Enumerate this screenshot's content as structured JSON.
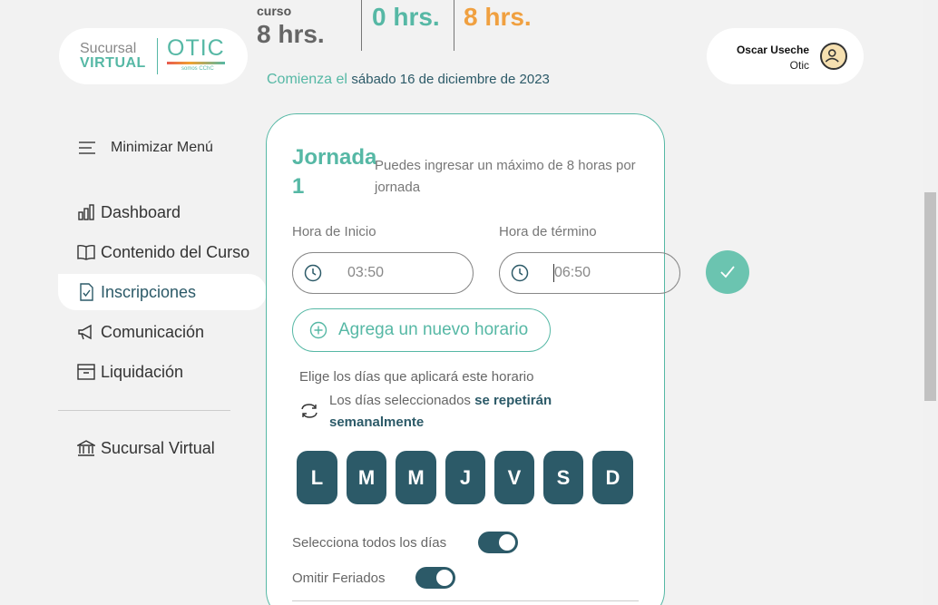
{
  "logo": {
    "line1": "Sucursal",
    "line2": "VIRTUAL",
    "brand": "OTIC",
    "brand_sub": "somos CChC"
  },
  "stats": {
    "curso_label": "curso",
    "curso_value": "8 hrs.",
    "value2": "0 hrs.",
    "value3": "8 hrs."
  },
  "begins": {
    "label": "Comienza el",
    "date": "sábado 16 de diciembre de 2023"
  },
  "user": {
    "name": "Oscar Useche",
    "org": "Otic"
  },
  "sidebar": {
    "toggle_label": "Minimizar Menú",
    "items": [
      {
        "label": "Dashboard",
        "icon": "bar-chart-icon"
      },
      {
        "label": "Contenido del Curso",
        "icon": "book-icon"
      },
      {
        "label": "Inscripciones",
        "icon": "document-check-icon"
      },
      {
        "label": "Comunicación",
        "icon": "megaphone-icon"
      },
      {
        "label": "Liquidación",
        "icon": "archive-icon"
      }
    ],
    "bottom_item": {
      "label": "Sucursal Virtual",
      "icon": "bank-icon"
    }
  },
  "card": {
    "title": "Jornada 1",
    "help": "Puedes ingresar un máximo de 8 horas por jornada",
    "start_label": "Hora de Inicio",
    "start_value": "03:50",
    "end_label": "Hora de término",
    "end_value": "06:50",
    "add_label": "Agrega un nuevo horario",
    "choose_days": "Elige los días que aplicará este horario",
    "repeat_prefix": "Los días seleccionados",
    "repeat_bold": "se repetirán semanalmente",
    "days": [
      "L",
      "M",
      "M",
      "J",
      "V",
      "S",
      "D"
    ],
    "select_all_label": "Selecciona todos los días",
    "skip_holidays_label": "Omitir Feriados"
  },
  "colors": {
    "teal": "#56b8a5",
    "dark_teal": "#2c5a68",
    "orange": "#f0a040"
  }
}
